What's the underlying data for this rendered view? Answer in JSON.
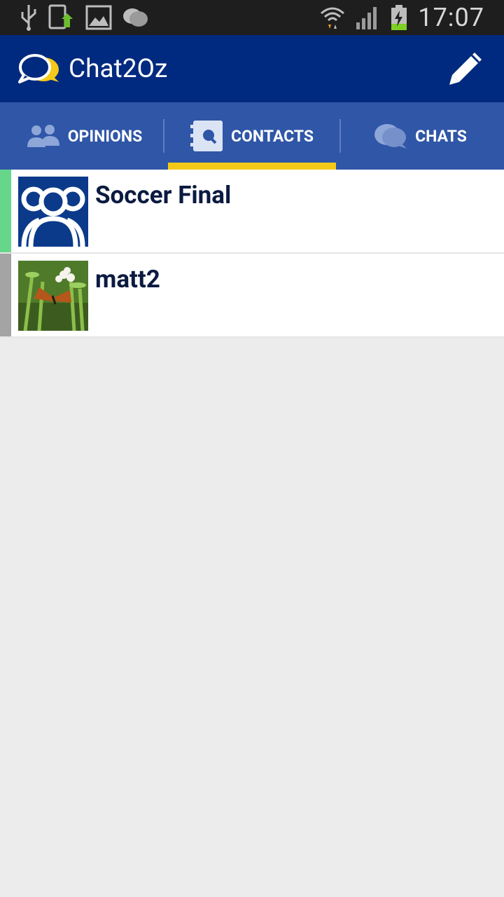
{
  "status_bar": {
    "time": "17:07",
    "left_icons": [
      "usb-icon",
      "phone-sync-icon",
      "image-icon",
      "chat-notification-icon"
    ],
    "right_icons": [
      "wifi-icon",
      "signal-icon",
      "battery-charging-icon"
    ]
  },
  "app_bar": {
    "title": "Chat2Oz",
    "logo_icon": "chat-bubbles-logo-icon",
    "action_icon": "pencil-icon"
  },
  "tabs": [
    {
      "label": "OPINIONS",
      "icon": "people-icon",
      "active": false
    },
    {
      "label": "CONTACTS",
      "icon": "contacts-book-icon",
      "active": true
    },
    {
      "label": "CHATS",
      "icon": "chat-bubbles-icon",
      "active": false
    }
  ],
  "colors": {
    "app_bar": "#002a7f",
    "tab_bar": "#2f56a7",
    "tab_indicator": "#f5c917",
    "row1_bar": "#66d68a",
    "row2_bar": "#a4a4a4"
  },
  "contacts": [
    {
      "name": "Soccer Final",
      "avatar": "group-avatar-icon"
    },
    {
      "name": "matt2",
      "avatar": "butterfly-photo"
    }
  ]
}
